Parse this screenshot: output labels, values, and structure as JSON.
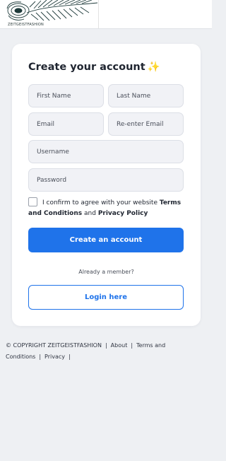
{
  "header": {
    "logo_text": "ZEITGEISTFASHION"
  },
  "form": {
    "title": "Create your account",
    "title_emoji": "✨",
    "first_name_placeholder": "First Name",
    "last_name_placeholder": "Last Name",
    "email_placeholder": "Email",
    "reenter_email_placeholder": "Re-enter Email",
    "username_placeholder": "Username",
    "password_placeholder": "Password",
    "consent_text": "I confirm to agree with your website",
    "terms_link": "Terms and Conditions",
    "consent_and": "and",
    "privacy_link": "Privacy Policy",
    "consent_checked": false,
    "create_button": "Create an account",
    "already_member": "Already a member?",
    "login_button": "Login here"
  },
  "footer": {
    "copyright": "© COPYRIGHT ZEITGEISTFASHION",
    "links": [
      "About",
      "Terms and Conditions",
      "Privacy"
    ],
    "separator": "|"
  },
  "colors": {
    "accent": "#1f73ea",
    "background": "#eef0f3",
    "field_bg": "#f1f2f6"
  }
}
